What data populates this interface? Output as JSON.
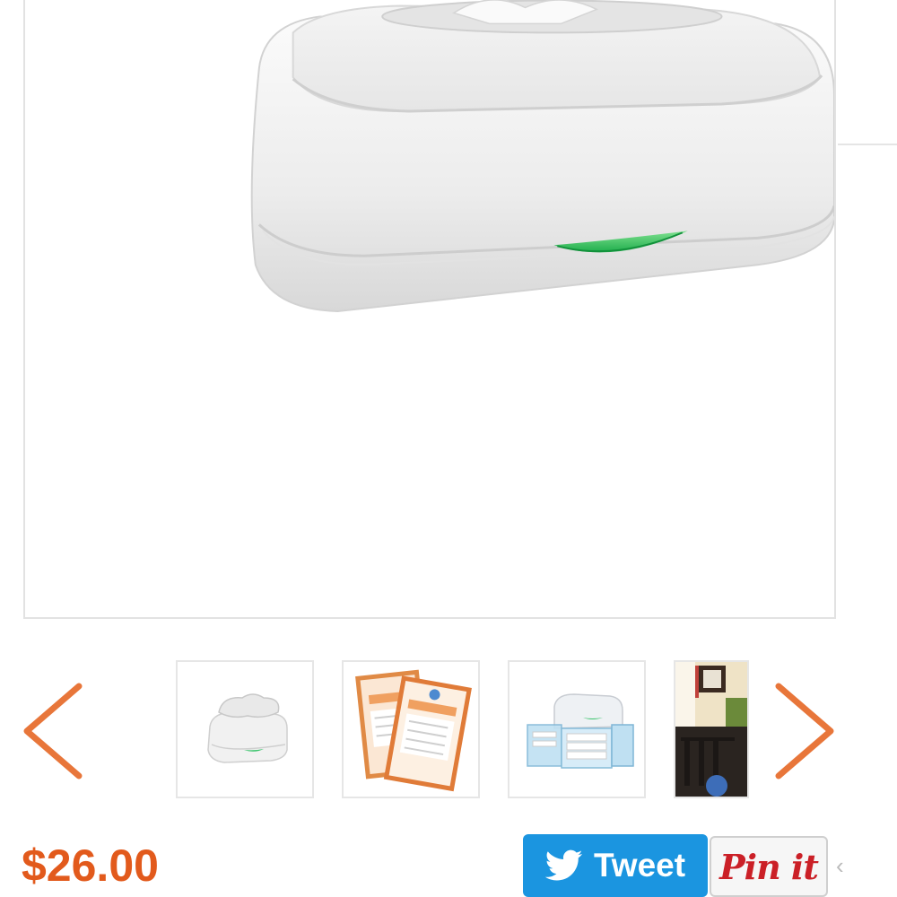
{
  "product": {
    "price": "$26.00",
    "main_image_alt": "Baby wipes warmer"
  },
  "gallery": {
    "prev_icon": "chevron-left-icon",
    "next_icon": "chevron-right-icon",
    "arrow_color": "#e8763a",
    "thumbnails": [
      {
        "subject": "wipes warmer"
      },
      {
        "subject": "replacement pillow packs"
      },
      {
        "subject": "warmer with caddy organizer"
      },
      {
        "subject": "nursery room"
      }
    ]
  },
  "share": {
    "tweet_label": "Tweet",
    "tweet_icon": "twitter-bird-icon",
    "tweet_color": "#1b95e0",
    "pin_label": "Pin it",
    "pin_color": "#cb2027"
  },
  "colors": {
    "price": "#e25a1c",
    "accent_green": "#39c46b"
  }
}
